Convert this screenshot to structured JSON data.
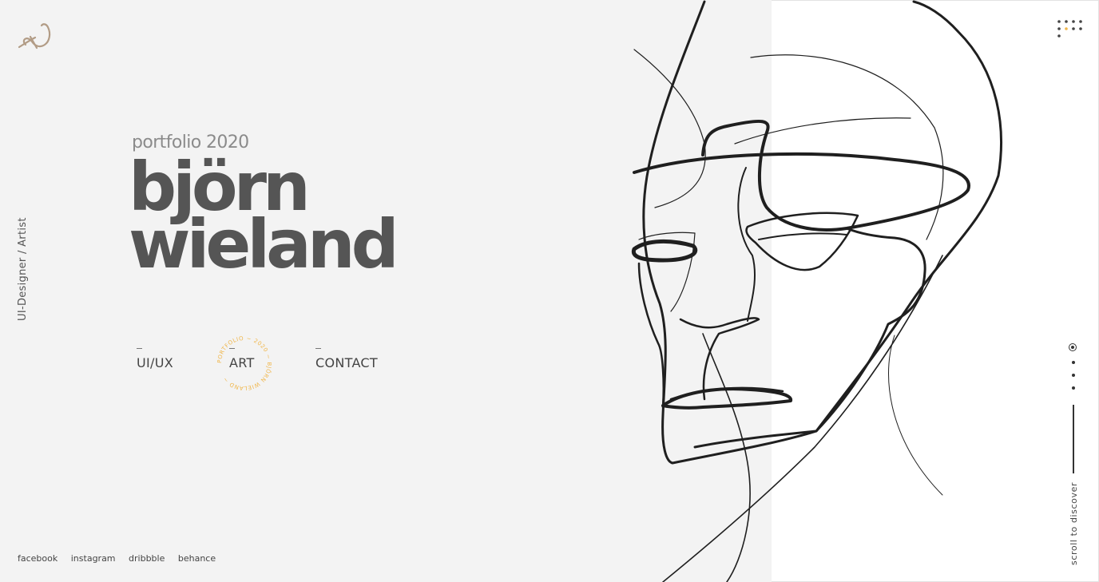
{
  "hero": {
    "tagline": "UI-Designer / Artist",
    "subtitle": "portfolio 2020",
    "name_line1": "björn",
    "name_line2": "wieland"
  },
  "nav": {
    "items": [
      {
        "label": "UI/UX"
      },
      {
        "label": "ART"
      },
      {
        "label": "CONTACT"
      }
    ],
    "active_ring_text": "PORTFOLIO ~ 2020 ~ BJÖRN WIELAND ~"
  },
  "social": [
    "facebook",
    "instagram",
    "dribbble",
    "behance"
  ],
  "scroll": {
    "label": "scroll to discover"
  },
  "colors": {
    "accent": "#f0b64a",
    "left_bg": "#f3f3f3",
    "logo": "#b29c86",
    "text_dark": "#555555"
  },
  "icons": {
    "logo": "bw-monogram-icon",
    "menu": "dot-grid-menu-icon",
    "artwork": "face-line-drawing"
  }
}
